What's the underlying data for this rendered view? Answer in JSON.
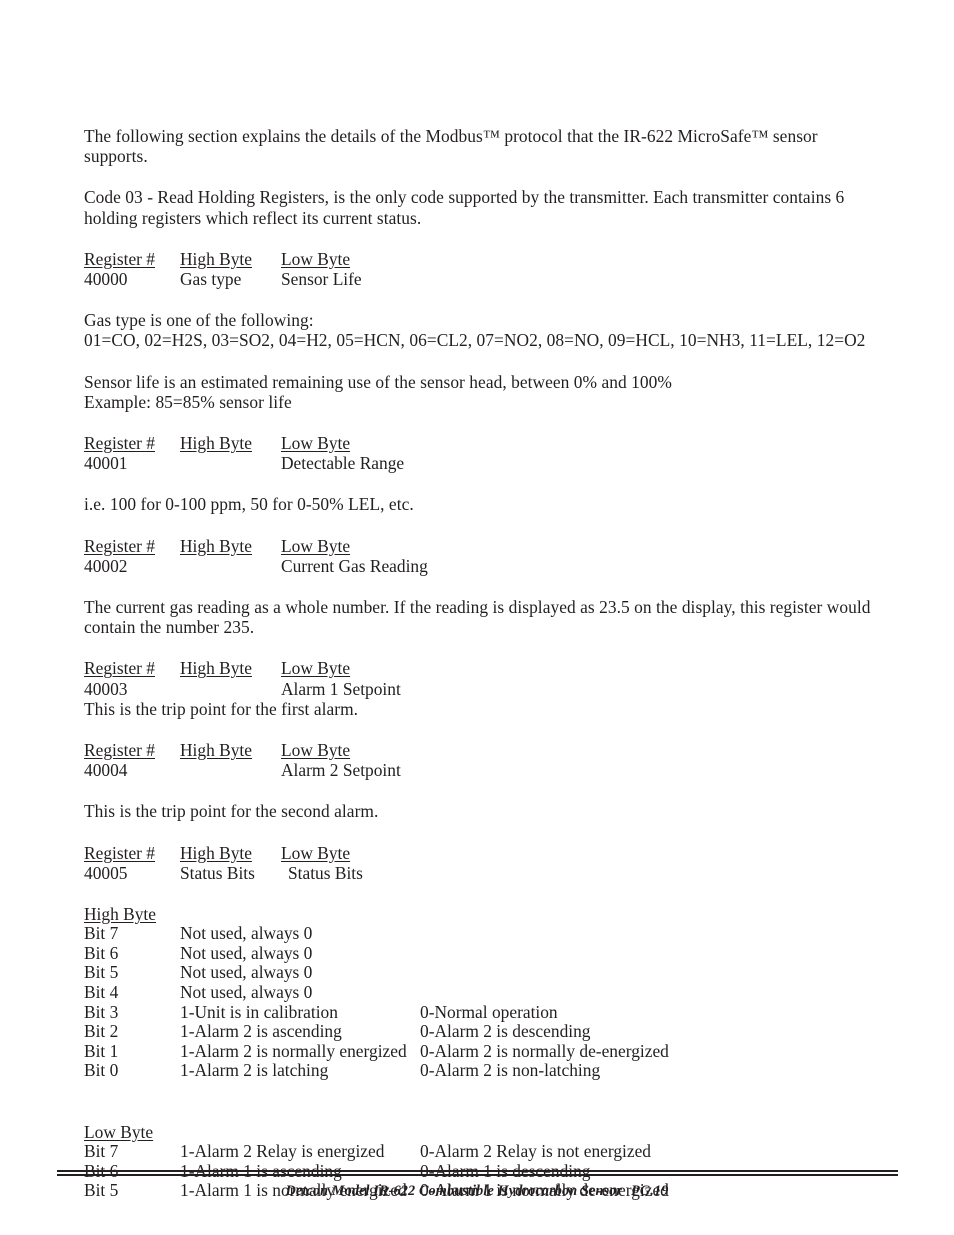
{
  "document": {
    "intro": "The following section explains the details of the Modbus™ protocol that the IR-622 MicroSafe™ sensor supports.",
    "code_paragraph": "Code 03 - Read Holding Registers, is the only code supported by the transmitter. Each transmitter contains 6 holding registers which reflect its current status.",
    "column_headers": {
      "register": "Register #",
      "high_byte": "High Byte",
      "low_byte": "Low Byte"
    },
    "registers": [
      {
        "number": "40000",
        "high_byte": "Gas type",
        "low_byte": "Sensor Life",
        "notes": [
          "Gas type is one of the following:",
          "01=CO, 02=H2S, 03=SO2, 04=H2, 05=HCN, 06=CL2, 07=NO2, 08=NO, 09=HCL, 10=NH3, 11=LEL, 12=O2",
          "Sensor life is an estimated remaining use of the sensor head, between 0% and 100%",
          "Example:  85=85% sensor life"
        ]
      },
      {
        "number": "40001",
        "high_byte": "",
        "low_byte": "Detectable Range",
        "notes": [
          "i.e. 100 for 0-100 ppm, 50 for 0-50% LEL, etc."
        ]
      },
      {
        "number": "40002",
        "high_byte": "",
        "low_byte": "Current Gas Reading",
        "notes": [
          "The current gas reading as a whole number. If the reading is displayed as 23.5 on the display, this register would contain the number 235."
        ]
      },
      {
        "number": "40003",
        "high_byte": "",
        "low_byte": "Alarm 1 Setpoint",
        "notes": [
          "This is the trip point for the first alarm."
        ]
      },
      {
        "number": "40004",
        "high_byte": "",
        "low_byte": "Alarm 2 Setpoint",
        "notes": [
          "This is the trip point for the second alarm."
        ]
      },
      {
        "number": "40005",
        "high_byte": "Status Bits",
        "low_byte": "Status Bits",
        "notes": []
      }
    ],
    "bit_groups": [
      {
        "title": "High Byte",
        "bits": [
          {
            "label": "Bit 7",
            "one": "Not used, always 0",
            "zero": ""
          },
          {
            "label": "Bit 6",
            "one": "Not used, always 0",
            "zero": ""
          },
          {
            "label": "Bit 5",
            "one": "Not used, always 0",
            "zero": ""
          },
          {
            "label": "Bit 4",
            "one": "Not used, always 0",
            "zero": ""
          },
          {
            "label": "Bit 3",
            "one": "1-Unit is in calibration",
            "zero": "0-Normal operation"
          },
          {
            "label": "Bit 2",
            "one": "1-Alarm 2 is ascending",
            "zero": "0-Alarm 2 is descending"
          },
          {
            "label": "Bit 1",
            "one": "1-Alarm 2 is normally energized",
            "zero": "0-Alarm 2 is normally de-energized"
          },
          {
            "label": "Bit 0",
            "one": "1-Alarm 2 is latching",
            "zero": "0-Alarm 2 is non-latching"
          }
        ]
      },
      {
        "title": "Low Byte",
        "bits": [
          {
            "label": "Bit 7",
            "one": "1-Alarm 2 Relay is energized",
            "zero": "0-Alarm 2 Relay is not energized"
          },
          {
            "label": "Bit 6",
            "one": "1-Alarm 1 is ascending",
            "zero": "0-Alarm 1 is descending"
          },
          {
            "label": "Bit 5",
            "one": "1-Alarm 1 is normally energized",
            "zero": "0-Alarm 1 is normally de-energized"
          }
        ]
      }
    ],
    "footer": {
      "title": "Detcon Model IR-622 Combustible Hydrocarbon Sensor",
      "page": "PG.19"
    }
  }
}
